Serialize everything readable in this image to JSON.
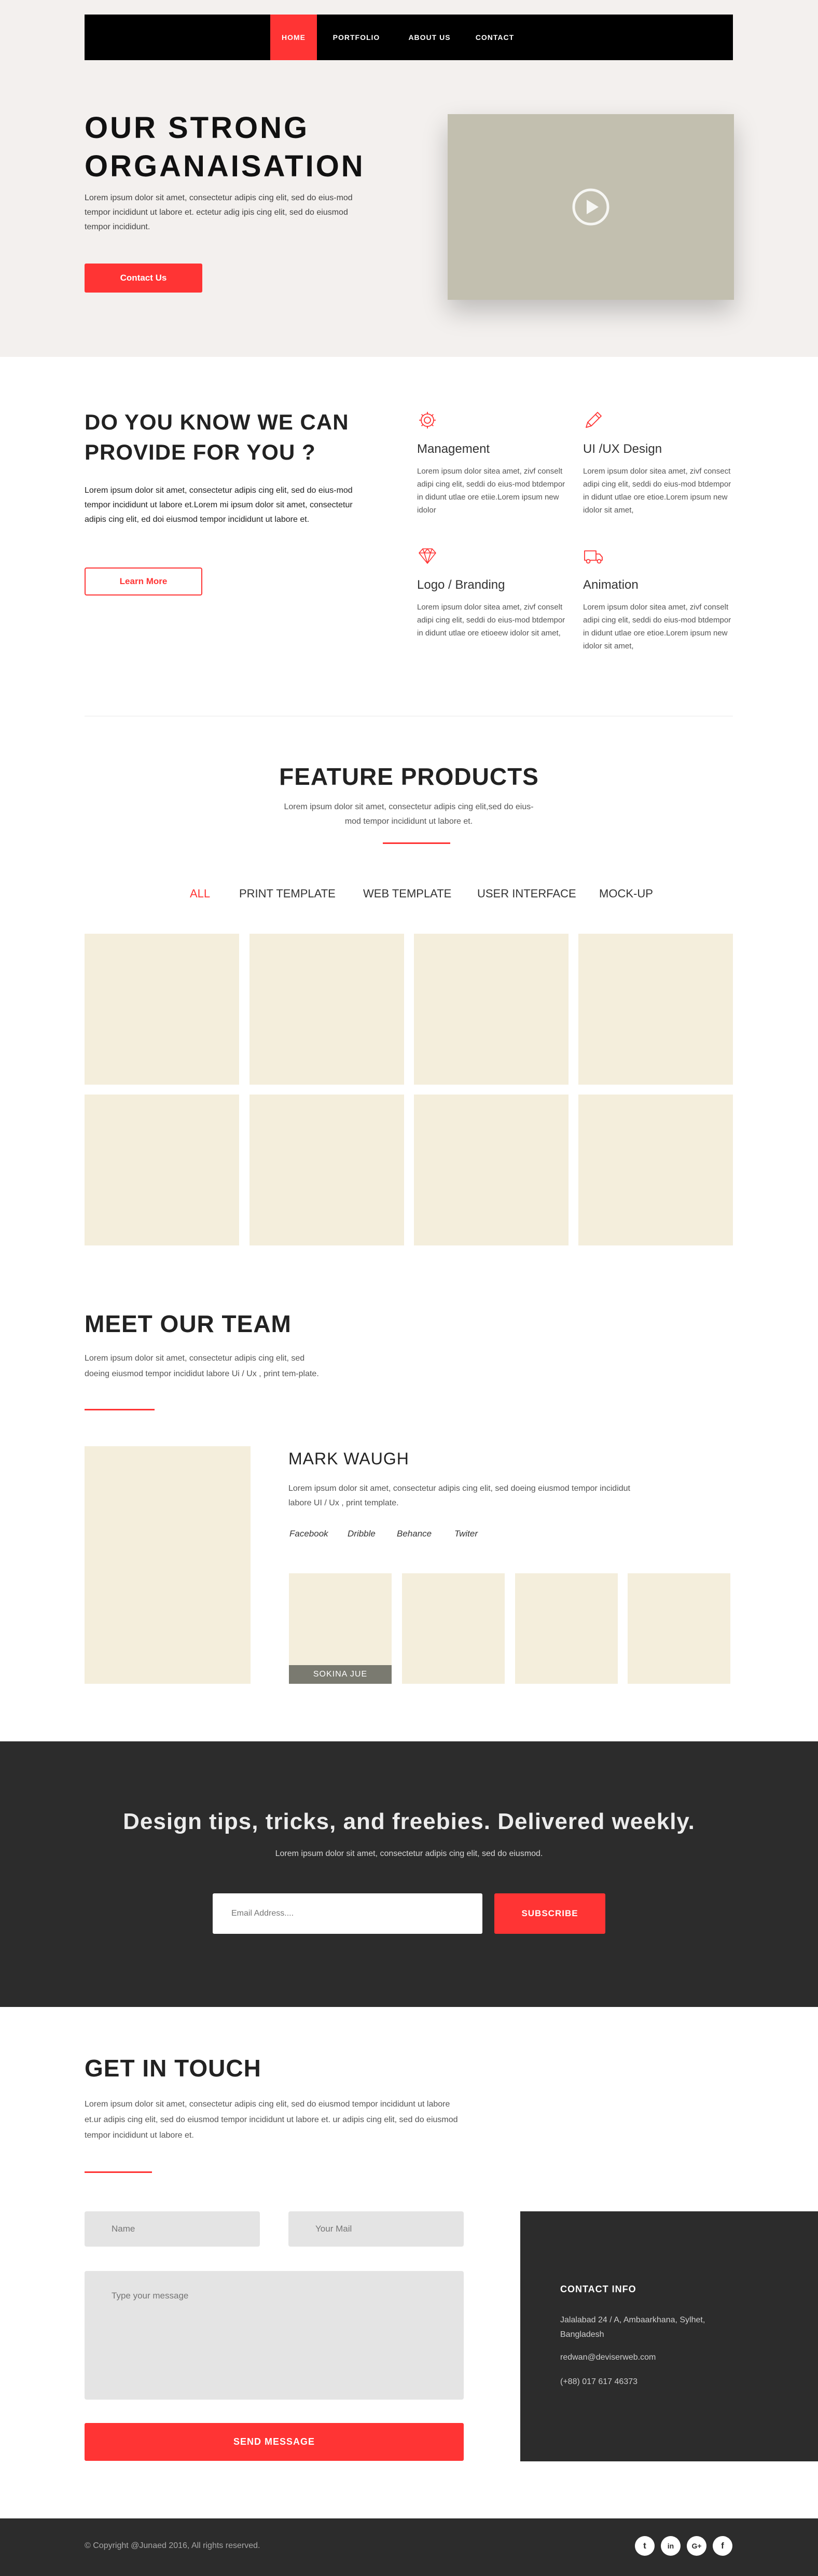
{
  "nav": {
    "items": [
      {
        "label": "HOME",
        "active": true
      },
      {
        "label": "PORTFOLIO",
        "active": false
      },
      {
        "label": "ABOUT US",
        "active": false
      },
      {
        "label": "CONTACT",
        "active": false
      }
    ]
  },
  "hero": {
    "title_line1": "OUR STRONG",
    "title_line2": "ORGANAISATION",
    "text": "Lorem ipsum dolor sit amet, consectetur adipis cing elit, sed do eius-mod tempor incididunt  ut labore et. ectetur adig ipis cing elit, sed do eiusmod tempor incididunt.",
    "button": "Contact Us",
    "video_icon": "play-icon"
  },
  "services": {
    "title": "DO YOU KNOW WE CAN PROVIDE FOR YOU ?",
    "text": "Lorem ipsum dolor sit amet, consectetur adipis cing elit, sed do eius-mod tempor incididunt ut labore et.Lorem mi ipsum dolor sit amet, consectetur adipis cing elit, ed doi eiusmod tempor incididunt ut labore et.",
    "button": "Learn More",
    "items": [
      {
        "icon": "gear-icon",
        "name": "Management",
        "desc": "Lorem ipsum dolor sitea amet, zivf conselt  adipi cing elit, seddi do eius-mod btdempor in didunt utlae ore etiie.Lorem ipsum new idolor"
      },
      {
        "icon": "pencil-icon",
        "name": "UI /UX Design",
        "desc": "Lorem ipsum dolor sitea amet, zivf consect  adipi cing elit, seddi do eius-mod btdempor in didunt utlae ore etioe.Lorem ipsum new idolor sit amet,"
      },
      {
        "icon": "diamond-icon",
        "name": "Logo / Branding",
        "desc": "Lorem ipsum dolor sitea amet, zivf conselt  adipi cing elit, seddi do eius-mod btdempor in didunt utlae ore etioeew idolor sit amet,"
      },
      {
        "icon": "truck-icon",
        "name": "Animation",
        "desc": "Lorem ipsum dolor sitea amet, zivf conselt  adipi cing elit, seddi do eius-mod btdempor in didunt utlae ore etioe.Lorem ipsum new idolor sit amet,"
      }
    ]
  },
  "features": {
    "title": "FEATURE PRODUCTS",
    "text": "Lorem ipsum dolor sit amet, consectetur adipis cing elit,sed do eius-mod tempor incididunt ut labore et.",
    "filters": [
      "ALL",
      "PRINT TEMPLATE",
      "WEB TEMPLATE",
      "USER INTERFACE",
      "MOCK-UP"
    ],
    "active_filter": "ALL",
    "tile_color": "#f4eedc"
  },
  "team": {
    "title": "MEET OUR TEAM",
    "text": "Lorem ipsum dolor sit amet, consectetur adipis cing elit, sed doeing eiusmod tempor incididut labore Ui / Ux , print tem-plate.",
    "member": {
      "name": "MARK WAUGH",
      "text": "Lorem ipsum dolor sit amet, consectetur adipis cing elit, sed doeing eiusmod tempor incididut labore UI / Ux , print template.",
      "links": [
        "Facebook",
        "Dribble",
        "Behance",
        "Twiter"
      ]
    },
    "thumbs": [
      {
        "label": "SOKINA JUE"
      },
      {
        "label": ""
      },
      {
        "label": ""
      },
      {
        "label": ""
      }
    ]
  },
  "newsletter": {
    "title": "Design tips, tricks, and freebies. Delivered weekly.",
    "text": "Lorem ipsum dolor sit amet, consectetur adipis cing elit, sed do eiusmod.",
    "placeholder": "Email Address....",
    "button": "SUBSCRIBE"
  },
  "contact": {
    "title": "GET IN TOUCH",
    "text": "Lorem ipsum dolor sit amet, consectetur adipis cing elit, sed do eiusmod tempor incididunt ut labore et.ur adipis cing elit, sed do eiusmod tempor incididunt ut labore et. ur adipis cing elit, sed do eiusmod tempor incididunt ut labore et.",
    "name_placeholder": "Name",
    "mail_placeholder": "Your Mail",
    "message_placeholder": "Type your message",
    "button": "SEND MESSAGE",
    "info": {
      "title": "CONTACT INFO",
      "address": "Jalalabad 24 / A, Ambaarkhana, Sylhet, Bangladesh",
      "email": "redwan@deviserweb.com",
      "phone": "(+88) 017 617 46373"
    }
  },
  "footer": {
    "copyright": "© Copyright @Junaed 2016, All rights reserved.",
    "socials": [
      {
        "icon": "twitter-icon",
        "glyph": "t"
      },
      {
        "icon": "linkedin-icon",
        "glyph": "in"
      },
      {
        "icon": "google-plus-icon",
        "glyph": "G+"
      },
      {
        "icon": "facebook-icon",
        "glyph": "f"
      }
    ]
  },
  "colors": {
    "accent": "#ff3434",
    "dark": "#2c2c2c",
    "hero_bg": "#f3f0ee",
    "video_bg": "#c2bfaf"
  }
}
